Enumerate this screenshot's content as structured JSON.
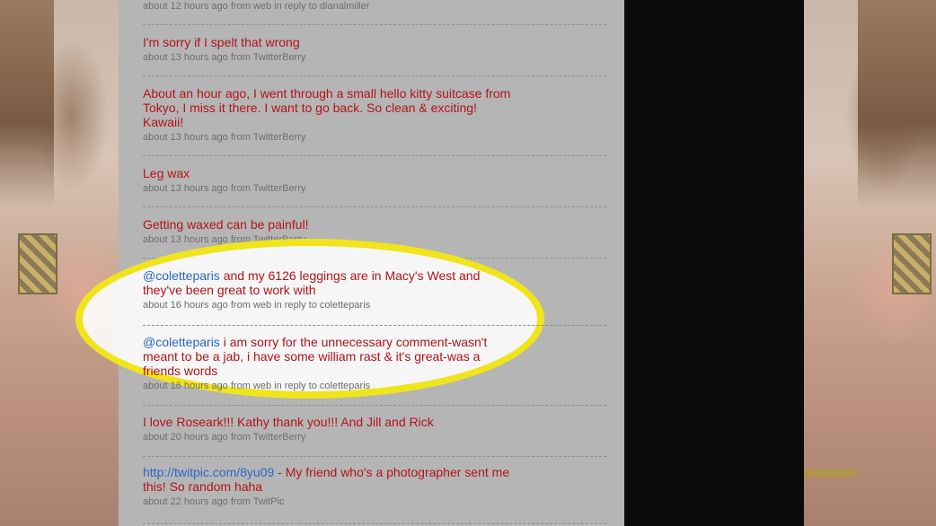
{
  "colors": {
    "tweet_text": "#b3131a",
    "mention": "#2a66c9",
    "meta": "#6e6e6e",
    "highlight_ring": "#f0e41c"
  },
  "tweets": [
    {
      "text": "",
      "meta": "about 12 hours ago from web in reply to dianalmiller"
    },
    {
      "text": "I'm sorry if I spelt that wrong",
      "meta": "about 13 hours ago from TwitterBerry"
    },
    {
      "text": "About an hour ago, I went through a small hello kitty suitcase from Tokyo, I miss it there. I want to go back. So clean & exciting! Kawaii!",
      "meta": "about 13 hours ago from TwitterBerry"
    },
    {
      "text": "Leg wax",
      "meta": "about 13 hours ago from TwitterBerry"
    },
    {
      "text": "Getting waxed can be painful!",
      "meta": "about 13 hours ago from TwitterBerry"
    },
    {
      "mention": "@coletteparis",
      "text": " and my 6126 leggings are in Macy's West and they've been great to work with",
      "meta": "about 16 hours ago from web in reply to coletteparis"
    },
    {
      "mention": "@coletteparis",
      "text": " i am sorry for the unnecessary comment-wasn't meant to be a jab, i have some william rast & it's great-was a friends words",
      "meta": "about 16 hours ago from web in reply to coletteparis"
    },
    {
      "text": "I love Roseark!!! Kathy thank you!!! And Jill and Rick",
      "meta": "about 20 hours ago from TwitterBerry"
    },
    {
      "link": "http://twitpic.com/8yu09",
      "text": " - My friend who's a photographer sent me this! So random haha",
      "meta": "about 22 hours ago from TwitPic"
    }
  ]
}
